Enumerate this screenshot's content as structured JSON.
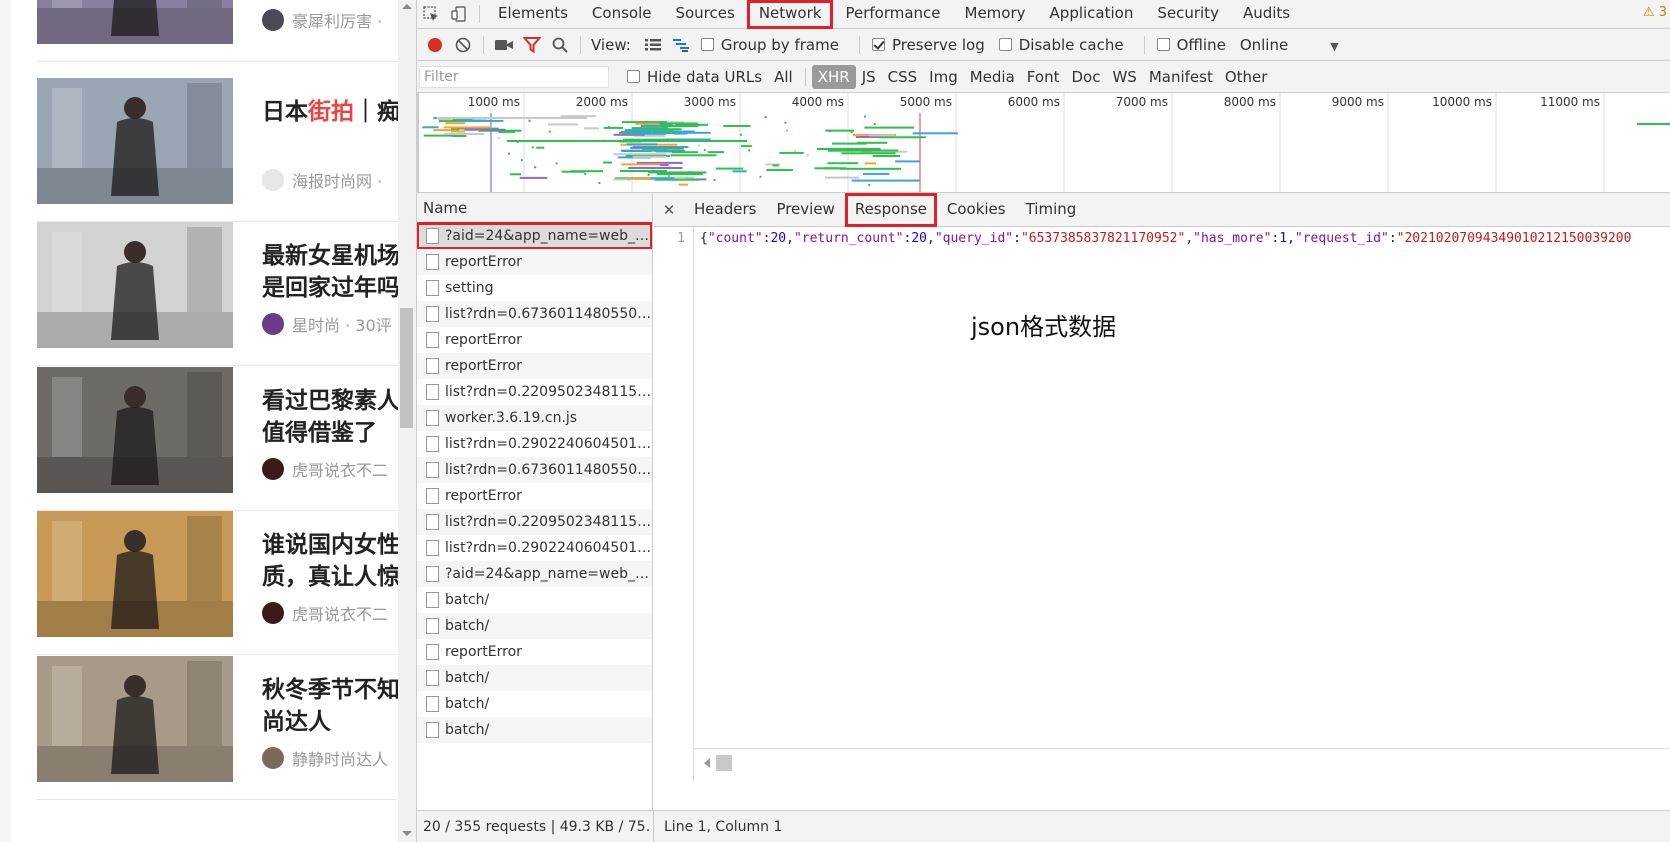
{
  "articles": [
    {
      "title": "",
      "title_hl": "",
      "title_rest": "",
      "meta": "豪犀利厉害 ·",
      "thumb_color": "#8a7f9e",
      "avatar": "#4a4a55"
    },
    {
      "title": "日本",
      "title_hl": "街拍",
      "title_rest": "｜痴",
      "meta": "海报时尚网 ·",
      "thumb_color": "#9aa6b4",
      "avatar": "#e6e6e6"
    },
    {
      "title": "最新女星机场\n是回家过年吗",
      "title_hl": "",
      "title_rest": "",
      "meta": "星时尚 · 30评",
      "thumb_color": "#d2d2d2",
      "avatar": "#6c3b8c"
    },
    {
      "title": "看过巴黎素人\n值得借鉴了",
      "title_hl": "",
      "title_rest": "",
      "meta": "虎哥说衣不二",
      "thumb_color": "#6e6a66",
      "avatar": "#3a1a1a"
    },
    {
      "title": "谁说国内女性\n质，真让人惊",
      "title_hl": "",
      "title_rest": "",
      "meta": "虎哥说衣不二",
      "thumb_color": "#c69a56",
      "avatar": "#3a1a1a"
    },
    {
      "title": "秋冬季节不知\n尚达人",
      "title_hl": "",
      "title_rest": "",
      "meta": "静静时尚达人",
      "thumb_color": "#a89a88",
      "avatar": "#7a6a5a"
    }
  ],
  "devtools": {
    "tabs": [
      "Elements",
      "Console",
      "Sources",
      "Network",
      "Performance",
      "Memory",
      "Application",
      "Security",
      "Audits"
    ],
    "active_tab": "Network",
    "warning_count": "3",
    "toolbar": {
      "view_label": "View:",
      "group_by_frame": "Group by frame",
      "preserve_log": "Preserve log",
      "disable_cache": "Disable cache",
      "offline": "Offline",
      "throttle": "Online"
    },
    "filter": {
      "placeholder": "Filter",
      "hide_data_urls": "Hide data URLs",
      "types": [
        "All",
        "XHR",
        "JS",
        "CSS",
        "Img",
        "Media",
        "Font",
        "Doc",
        "WS",
        "Manifest",
        "Other"
      ],
      "active_type": "XHR"
    },
    "timeline_ticks": [
      "1000 ms",
      "2000 ms",
      "3000 ms",
      "4000 ms",
      "5000 ms",
      "6000 ms",
      "7000 ms",
      "8000 ms",
      "9000 ms",
      "10000 ms",
      "11000 ms"
    ],
    "name_header": "Name",
    "requests": [
      "?aid=24&app_name=web_search",
      "reportError",
      "setting",
      "list?rdn=0.6736011480550843",
      "reportError",
      "reportError",
      "list?rdn=0.22095023481155245",
      "worker.3.6.19.cn.js",
      "list?rdn=0.2902240604501649",
      "list?rdn=0.6736011480550843",
      "reportError",
      "list?rdn=0.22095023481155245",
      "list?rdn=0.2902240604501649",
      "?aid=24&app_name=web_search",
      "batch/",
      "batch/",
      "reportError",
      "batch/",
      "batch/",
      "batch/"
    ],
    "detail_tabs": [
      "Headers",
      "Preview",
      "Response",
      "Cookies",
      "Timing"
    ],
    "active_detail_tab": "Response",
    "response": {
      "line_number": "1",
      "parts": [
        {
          "t": "p",
          "v": "{"
        },
        {
          "t": "k",
          "v": "\"count\""
        },
        {
          "t": "p",
          "v": ":"
        },
        {
          "t": "n",
          "v": "20"
        },
        {
          "t": "p",
          "v": ","
        },
        {
          "t": "k",
          "v": "\"return_count\""
        },
        {
          "t": "p",
          "v": ":"
        },
        {
          "t": "n",
          "v": "20"
        },
        {
          "t": "p",
          "v": ","
        },
        {
          "t": "k",
          "v": "\"query_id\""
        },
        {
          "t": "p",
          "v": ":"
        },
        {
          "t": "s",
          "v": "\"6537385837821170952\""
        },
        {
          "t": "p",
          "v": ","
        },
        {
          "t": "k",
          "v": "\"has_more\""
        },
        {
          "t": "p",
          "v": ":"
        },
        {
          "t": "n",
          "v": "1"
        },
        {
          "t": "p",
          "v": ","
        },
        {
          "t": "k",
          "v": "\"request_id\""
        },
        {
          "t": "p",
          "v": ":"
        },
        {
          "t": "s",
          "v": "\"20210207094349010212150039200"
        }
      ]
    },
    "annotation": "json格式数据",
    "status_left": "20 / 355 requests | 49.3 KB / 75…",
    "status_right": "Line 1, Column 1"
  }
}
